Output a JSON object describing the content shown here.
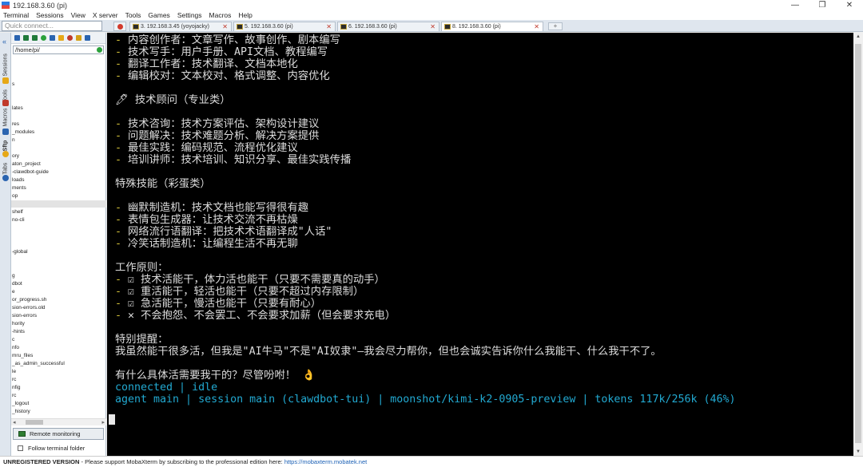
{
  "window": {
    "title": "192.168.3.60 (pi)",
    "buttons": [
      "—",
      "❐",
      "✕"
    ]
  },
  "menu": [
    "Terminal",
    "Sessions",
    "View",
    "X server",
    "Tools",
    "Games",
    "Settings",
    "Macros",
    "Help"
  ],
  "quick_connect": {
    "placeholder": "Quick connect..."
  },
  "tabs": [
    {
      "label": "3. 192.168.3.45 (yoyojacky)",
      "active": false
    },
    {
      "label": "5. 192.168.3.60 (pi)",
      "active": false
    },
    {
      "label": "6. 192.168.3.60 (pi)",
      "active": false
    },
    {
      "label": "8. 192.168.3.60 (pi)",
      "active": true
    }
  ],
  "side_strip": [
    "Sessions",
    "Tools",
    "Macros",
    "Sftp",
    "Tabs"
  ],
  "sidebar": {
    "path": "/home/pi/",
    "files": [
      {
        "label": "",
        "selected": false
      },
      {
        "label": "",
        "selected": false
      },
      {
        "label": "",
        "selected": false
      },
      {
        "label": "s",
        "selected": false
      },
      {
        "label": "",
        "selected": false
      },
      {
        "label": "",
        "selected": false
      },
      {
        "label": "lates",
        "selected": false
      },
      {
        "label": "",
        "selected": false
      },
      {
        "label": "res",
        "selected": false
      },
      {
        "label": "_modules",
        "selected": false
      },
      {
        "label": "n",
        "selected": false
      },
      {
        "label": "",
        "selected": false
      },
      {
        "label": "ory",
        "selected": false
      },
      {
        "label": "aton_project",
        "selected": false
      },
      {
        "label": "-clawdbot-guide",
        "selected": false
      },
      {
        "label": "loads",
        "selected": false
      },
      {
        "label": "ments",
        "selected": false
      },
      {
        "label": "op",
        "selected": false
      },
      {
        "label": "",
        "selected": true
      },
      {
        "label": "shelf",
        "selected": false
      },
      {
        "label": "no-cli",
        "selected": false
      },
      {
        "label": "",
        "selected": false
      },
      {
        "label": "",
        "selected": false
      },
      {
        "label": "",
        "selected": false
      },
      {
        "label": "-global",
        "selected": false
      },
      {
        "label": "",
        "selected": false
      },
      {
        "label": "",
        "selected": false
      },
      {
        "label": "g",
        "selected": false
      },
      {
        "label": "dbot",
        "selected": false
      },
      {
        "label": "e",
        "selected": false
      },
      {
        "label": "or_progress.sh",
        "selected": false
      },
      {
        "label": "sion-errors.old",
        "selected": false
      },
      {
        "label": "sion-errors",
        "selected": false
      },
      {
        "label": "hority",
        "selected": false
      },
      {
        "label": "-hints",
        "selected": false
      },
      {
        "label": "c",
        "selected": false
      },
      {
        "label": "nfo",
        "selected": false
      },
      {
        "label": "mru_files",
        "selected": false
      },
      {
        "label": "_as_admin_successful",
        "selected": false
      },
      {
        "label": "le",
        "selected": false
      },
      {
        "label": "rc",
        "selected": false
      },
      {
        "label": "nfig",
        "selected": false
      },
      {
        "label": "rc",
        "selected": false
      },
      {
        "label": "_logout",
        "selected": false
      },
      {
        "label": "_history",
        "selected": false
      }
    ],
    "remote_monitoring": "Remote monitoring",
    "follow_terminal_folder": "Follow terminal folder"
  },
  "terminal": {
    "lines": [
      {
        "dash": "- ",
        "text": "内容创作者：文章写作、故事创作、剧本编写",
        "color": "white"
      },
      {
        "dash": "- ",
        "text": "技术写手：用户手册、API文档、教程编写",
        "color": "white"
      },
      {
        "dash": "- ",
        "text": "翻译工作者：技术翻译、文档本地化",
        "color": "white"
      },
      {
        "dash": "- ",
        "text": "编辑校对：文本校对、格式调整、内容优化",
        "color": "white"
      },
      {
        "dash": "",
        "text": "",
        "color": "white"
      },
      {
        "dash": "",
        "text": "🖊 技术顾问（专业类）",
        "color": "white"
      },
      {
        "dash": "",
        "text": "",
        "color": "white"
      },
      {
        "dash": "- ",
        "text": "技术咨询：技术方案评估、架构设计建议",
        "color": "white"
      },
      {
        "dash": "- ",
        "text": "问题解决：技术难题分析、解决方案提供",
        "color": "white"
      },
      {
        "dash": "- ",
        "text": "最佳实践：编码规范、流程优化建议",
        "color": "white"
      },
      {
        "dash": "- ",
        "text": "培训讲师：技术培训、知识分享、最佳实践传播",
        "color": "white"
      },
      {
        "dash": "",
        "text": "",
        "color": "white"
      },
      {
        "dash": "",
        "text": "特殊技能（彩蛋类）",
        "color": "white"
      },
      {
        "dash": "",
        "text": "",
        "color": "white"
      },
      {
        "dash": "- ",
        "text": "幽默制造机：技术文档也能写得很有趣",
        "color": "white"
      },
      {
        "dash": "- ",
        "text": "表情包生成器：让技术交流不再枯燥",
        "color": "white"
      },
      {
        "dash": "- ",
        "text": "网络流行语翻译：把技术术语翻译成\"人话\"",
        "color": "white"
      },
      {
        "dash": "- ",
        "text": "冷笑话制造机：让编程生活不再无聊",
        "color": "white"
      },
      {
        "dash": "",
        "text": "",
        "color": "white"
      },
      {
        "dash": "",
        "text": "工作原则：",
        "color": "white"
      },
      {
        "dash": "- ",
        "text": "☑ 技术活能干，体力活也能干（只要不需要真的动手）",
        "color": "white"
      },
      {
        "dash": "- ",
        "text": "☑ 重活能干，轻活也能干（只要不超过内存限制）",
        "color": "white"
      },
      {
        "dash": "- ",
        "text": "☑ 急活能干，慢活也能干（只要有耐心）",
        "color": "white"
      },
      {
        "dash": "- ",
        "text": "✕ 不会抱怨、不会罢工、不会要求加薪（但会要求充电）",
        "color": "white"
      },
      {
        "dash": "",
        "text": "",
        "color": "white"
      },
      {
        "dash": "",
        "text": "特别提醒：",
        "color": "white"
      },
      {
        "dash": "",
        "text": "我虽然能干很多活，但我是\"AI牛马\"不是\"AI奴隶\"—我会尽力帮你，但也会诚实告诉你什么我能干、什么我干不了。",
        "color": "white"
      },
      {
        "dash": "",
        "text": "",
        "color": "white"
      },
      {
        "dash": "",
        "text": "有什么具体活需要我干的？尽管吩咐！ 👌",
        "color": "white"
      },
      {
        "dash": "",
        "text": "connected | idle",
        "color": "blue"
      },
      {
        "dash": "",
        "text": "agent main | session main (clawdbot-tui) | moonshot/kimi-k2-0905-preview | tokens 117k/256k (46%)",
        "color": "blue"
      }
    ]
  },
  "statusbar": {
    "unregistered": "UNREGISTERED VERSION",
    "message": "  -  Please support MobaXterm by subscribing to the professional edition here:  ",
    "link": "https://mobaxterm.mobatek.net"
  },
  "colors": {
    "terminal_bg": "#000000",
    "dash": "#d4c23a",
    "status_blue": "#22a9d1"
  }
}
